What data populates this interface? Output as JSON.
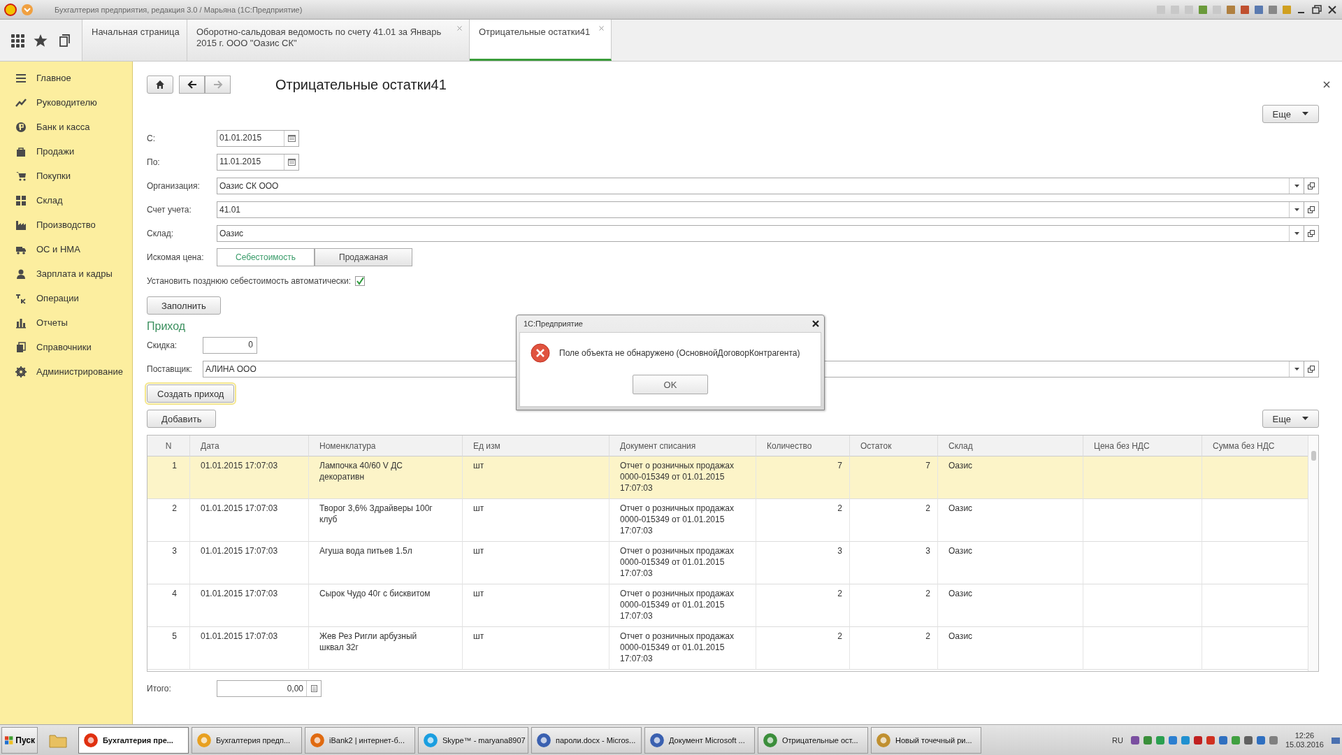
{
  "window": {
    "title": "Бухгалтерия предприятия, редакция 3.0 / Марьяна  (1С:Предприятие)"
  },
  "tabs": [
    {
      "label": "Начальная страница",
      "selected": false,
      "closable": false
    },
    {
      "label": "Оборотно-сальдовая ведомость по счету 41.01 за Январь 2015 г. ООО \"Оазис СК\"",
      "selected": false,
      "closable": true
    },
    {
      "label": "Отрицательные остатки41",
      "selected": true,
      "closable": true
    }
  ],
  "sidebar": {
    "items": [
      {
        "label": "Главное"
      },
      {
        "label": "Руководителю"
      },
      {
        "label": "Банк и касса"
      },
      {
        "label": "Продажи"
      },
      {
        "label": "Покупки"
      },
      {
        "label": "Склад"
      },
      {
        "label": "Производство"
      },
      {
        "label": "ОС и НМА"
      },
      {
        "label": "Зарплата и кадры"
      },
      {
        "label": "Операции"
      },
      {
        "label": "Отчеты"
      },
      {
        "label": "Справочники"
      },
      {
        "label": "Администрирование"
      }
    ]
  },
  "form": {
    "title": "Отрицательные остатки41",
    "more_button": "Еще",
    "fields": [
      {
        "kind": "date",
        "label": "С:",
        "value": "01.01.2015"
      },
      {
        "kind": "date",
        "label": "По:",
        "value": "11.01.2015"
      },
      {
        "kind": "select",
        "label": "Организация:",
        "value": "Оазис СК ООО"
      },
      {
        "kind": "select",
        "label": "Счет учета:",
        "value": "41.01"
      },
      {
        "kind": "select",
        "label": "Склад:",
        "value": "Оазис"
      }
    ],
    "price": {
      "label": "Искомая цена:",
      "options": [
        {
          "label": "Себестоимость",
          "selected": true
        },
        {
          "label": "Продажаная",
          "selected": false
        }
      ]
    },
    "auto_cost": {
      "label": "Установить позднюю себестоимость автоматически:",
      "checked": true
    },
    "fill_button": "Заполнить",
    "section": "Приход",
    "discount": {
      "label": "Скидка:",
      "value": "0"
    },
    "supplier": {
      "label": "Поставщик:",
      "value": "АЛИНА ООО"
    },
    "create_button": "Создать приход",
    "add_button": "Добавить",
    "table_more_button": "Еще",
    "table": {
      "columns": [
        "N",
        "Дата",
        "Номенклатура",
        "Ед изм",
        "Документ списания",
        "Количество",
        "Остаток",
        "Склад",
        "Цена без НДС",
        "Сумма без НДС"
      ],
      "rows": [
        {
          "selected": true,
          "cells": [
            "1",
            "01.01.2015 17:07:03",
            "Лампочка 40/60 V ДС декоративн",
            "шт",
            "Отчет о розничных продажах 0000-015349 от 01.01.2015 17:07:03",
            "7",
            "7",
            "Оазис"
          ]
        },
        {
          "selected": false,
          "cells": [
            "2",
            "01.01.2015 17:07:03",
            "Творог 3,6% Здрайверы 100г клуб",
            "шт",
            "Отчет о розничных продажах 0000-015349 от 01.01.2015 17:07:03",
            "2",
            "2",
            "Оазис"
          ]
        },
        {
          "selected": false,
          "cells": [
            "3",
            "01.01.2015 17:07:03",
            "Агуша вода питьев 1.5л",
            "шт",
            "Отчет о розничных продажах 0000-015349 от 01.01.2015 17:07:03",
            "3",
            "3",
            "Оазис"
          ]
        },
        {
          "selected": false,
          "cells": [
            "4",
            "01.01.2015 17:07:03",
            "Сырок Чудо 40г с бисквитом",
            "шт",
            "Отчет о розничных продажах 0000-015349 от 01.01.2015 17:07:03",
            "2",
            "2",
            "Оазис"
          ]
        },
        {
          "selected": false,
          "cells": [
            "5",
            "01.01.2015 17:07:03",
            "Жев Рез Ригли арбузный шквал 32г",
            "шт",
            "Отчет о розничных продажах 0000-015349 от 01.01.2015 17:07:03",
            "2",
            "2",
            "Оазис"
          ]
        }
      ]
    },
    "total": {
      "label": "Итого:",
      "value": "0,00"
    }
  },
  "dialog": {
    "title": "1С:Предприятие",
    "message": "Поле объекта не обнаружено (ОсновнойДоговорКонтрагента)",
    "ok_button": "OK"
  },
  "taskbar": {
    "start": "Пуск",
    "items": [
      {
        "label": "Бухгалтерия пре...",
        "selected": true
      },
      {
        "label": "Бухгалтерия предп...",
        "selected": false
      },
      {
        "label": "iBank2 | интернет-б...",
        "selected": false
      },
      {
        "label": "Skype™ - maryana8907",
        "selected": false
      },
      {
        "label": "пароли.docx - Micros...",
        "selected": false
      },
      {
        "label": "Документ Microsoft ...",
        "selected": false
      },
      {
        "label": "Отрицательные ост...",
        "selected": false
      },
      {
        "label": "Новый точечный ри...",
        "selected": false
      }
    ],
    "language": "RU",
    "time": "12:26",
    "date": "15.03.2016"
  }
}
